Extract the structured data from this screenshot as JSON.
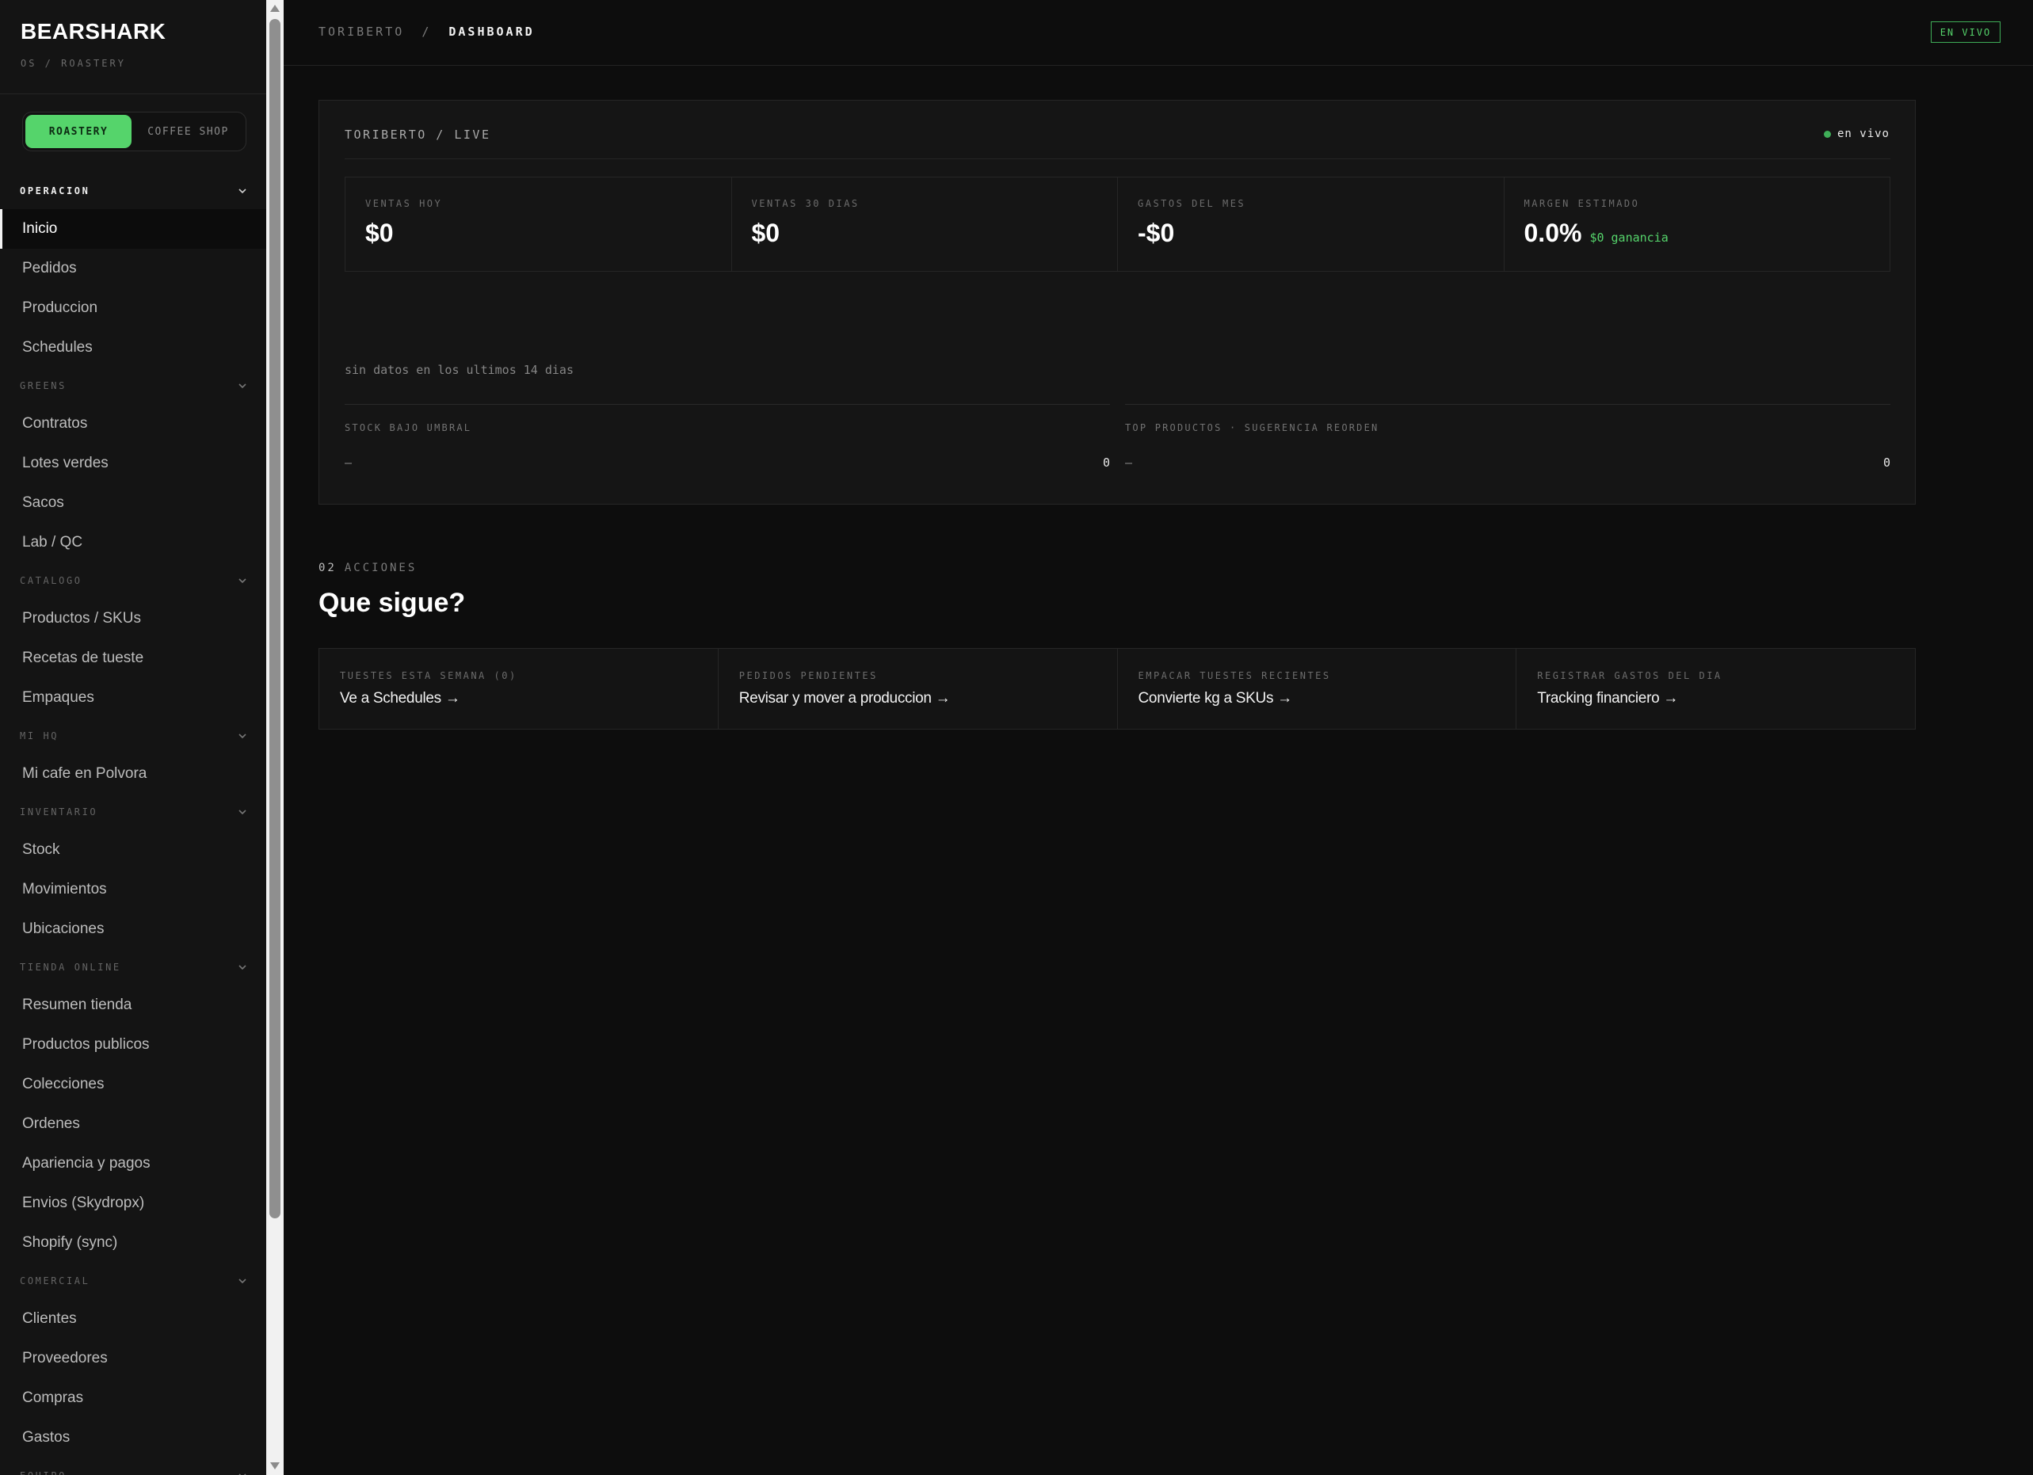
{
  "brand": {
    "name": "BEARSHARK",
    "subtitle": "OS / ROASTERY"
  },
  "mode_toggle": {
    "active": "ROASTERY",
    "inactive": "COFFEE SHOP"
  },
  "sidebar": {
    "sections": [
      {
        "title": "OPERACION",
        "active": true,
        "items": [
          "Inicio",
          "Pedidos",
          "Produccion",
          "Schedules"
        ]
      },
      {
        "title": "GREENS",
        "items": [
          "Contratos",
          "Lotes verdes",
          "Sacos",
          "Lab / QC"
        ]
      },
      {
        "title": "CATALOGO",
        "items": [
          "Productos / SKUs",
          "Recetas de tueste",
          "Empaques"
        ]
      },
      {
        "title": "MI HQ",
        "items": [
          "Mi cafe en Polvora"
        ]
      },
      {
        "title": "INVENTARIO",
        "items": [
          "Stock",
          "Movimientos",
          "Ubicaciones"
        ]
      },
      {
        "title": "TIENDA ONLINE",
        "items": [
          "Resumen tienda",
          "Productos publicos",
          "Colecciones",
          "Ordenes",
          "Apariencia y pagos",
          "Envios (Skydropx)",
          "Shopify (sync)"
        ]
      },
      {
        "title": "COMERCIAL",
        "items": [
          "Clientes",
          "Proveedores",
          "Compras",
          "Gastos"
        ]
      },
      {
        "title": "EQUIPO",
        "items": []
      }
    ],
    "current_item": "Inicio"
  },
  "topbar": {
    "crumb_root": "TORIBERTO",
    "crumb_sep": "/",
    "crumb_current": "DASHBOARD",
    "live_badge": "EN VIVO"
  },
  "panel": {
    "title": "TORIBERTO / LIVE",
    "live_text": "en vivo",
    "kpis": [
      {
        "label": "VENTAS HOY",
        "value": "$0"
      },
      {
        "label": "VENTAS 30 DIAS",
        "value": "$0"
      },
      {
        "label": "GASTOS DEL MES",
        "value": "-$0"
      },
      {
        "label": "MARGEN ESTIMADO",
        "value": "0.0%",
        "note": "$0 ganancia"
      }
    ],
    "no_data": "sin datos en los ultimos 14 dias",
    "stock_low": {
      "title": "STOCK BAJO UMBRAL",
      "dash": "—",
      "count": "0"
    },
    "top_products": {
      "title": "TOP PRODUCTOS · SUGERENCIA REORDEN",
      "dash": "—",
      "count": "0"
    }
  },
  "actions_section": {
    "number": "02",
    "label": "ACCIONES",
    "title": "Que sigue?",
    "cards": [
      {
        "label": "TUESTES ESTA SEMANA (0)",
        "link": "Ve a Schedules →"
      },
      {
        "label": "PEDIDOS PENDIENTES",
        "link": "Revisar y mover a produccion →"
      },
      {
        "label": "EMPACAR TUESTES RECIENTES",
        "link": "Convierte kg a SKUs →"
      },
      {
        "label": "REGISTRAR GASTOS DEL DIA",
        "link": "Tracking financiero →"
      }
    ]
  },
  "colors": {
    "accent_green": "#55d46b",
    "background": "#0d0d0d",
    "sidebar": "#141414"
  }
}
